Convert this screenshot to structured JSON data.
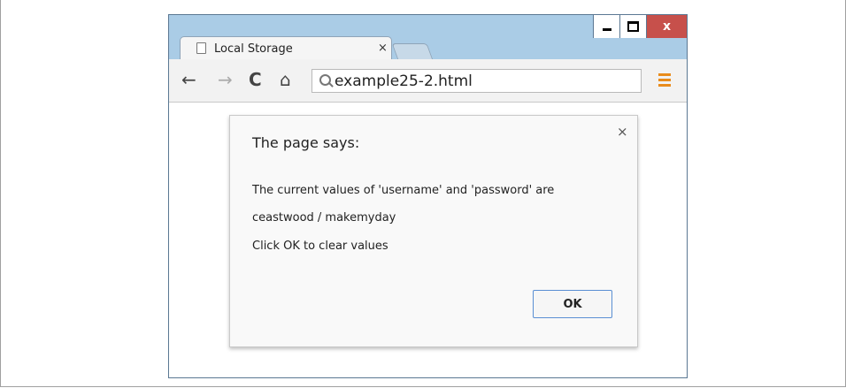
{
  "window": {
    "controls": {
      "minimize": "–",
      "maximize": "□",
      "close": "x"
    }
  },
  "tab": {
    "title": "Local Storage",
    "close": "×"
  },
  "toolbar": {
    "back": "←",
    "forward": "→",
    "reload": "C",
    "home": "⌂",
    "url": "example25-2.html"
  },
  "dialog": {
    "title": "The page says:",
    "close": "×",
    "lines": [
      "The current values of 'username' and 'password' are",
      "ceastwood / makemyday",
      "Click OK to clear values"
    ],
    "ok_label": "OK"
  },
  "colors": {
    "chrome_frame": "#aacce6",
    "close_button": "#c7504b",
    "menu_icon": "#e98c1c",
    "ok_border": "#5a8fd3"
  }
}
